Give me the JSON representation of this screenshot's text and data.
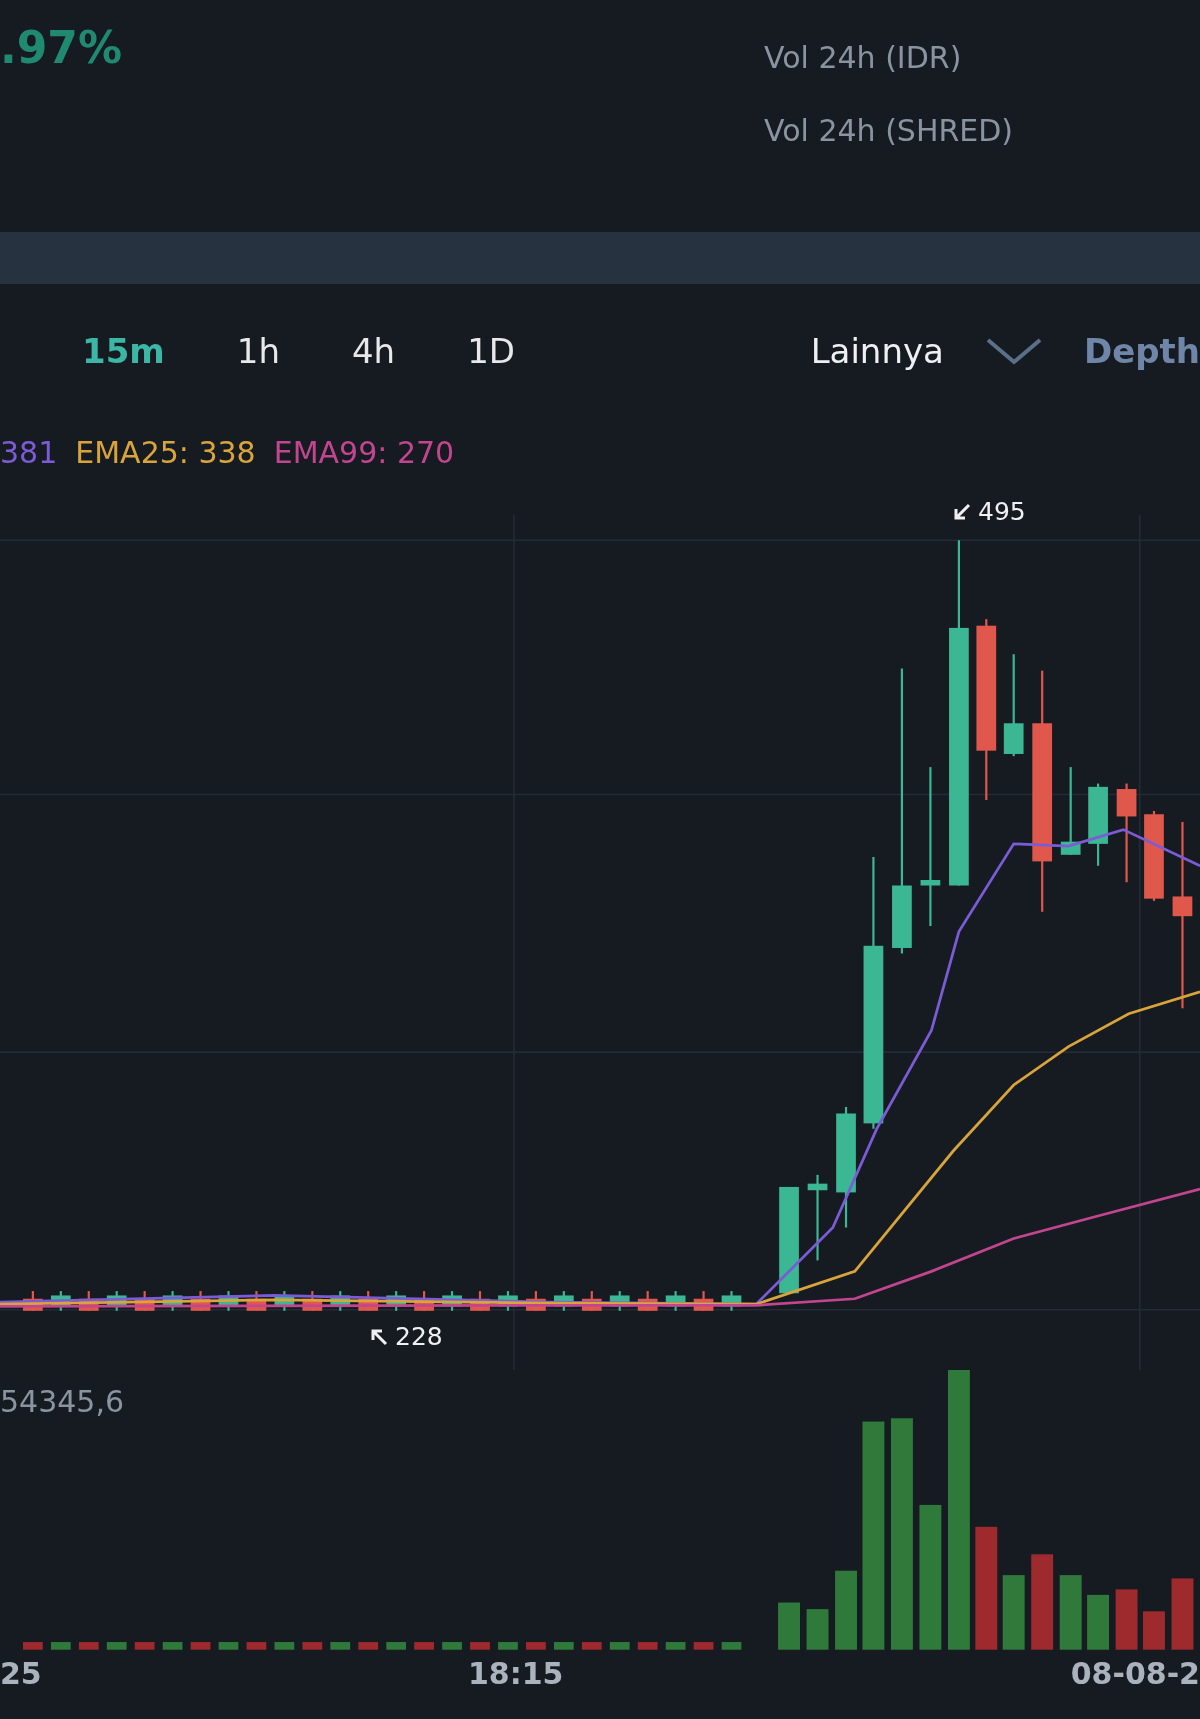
{
  "header": {
    "change": ".97%",
    "stats": [
      {
        "label": "Vol 24h (IDR)"
      },
      {
        "label": "Vol 24h (SHRED)"
      }
    ]
  },
  "toolbar": {
    "timeframes": [
      {
        "label": "15m",
        "selected": true
      },
      {
        "label": "1h",
        "selected": false
      },
      {
        "label": "4h",
        "selected": false
      },
      {
        "label": "1D",
        "selected": false
      }
    ],
    "more": "Lainnya",
    "depth": "Depth"
  },
  "indicators": [
    {
      "text": "381",
      "kind": "ema7"
    },
    {
      "text": "EMA25: 338",
      "kind": "ema25"
    },
    {
      "text": "EMA99: 270",
      "kind": "ema99"
    }
  ],
  "chart": {
    "high_marker": "495",
    "low_marker": "228"
  },
  "volume": {
    "reading": "54345,6"
  },
  "time_axis": [
    "25",
    "18:15",
    "08-08-2"
  ]
}
